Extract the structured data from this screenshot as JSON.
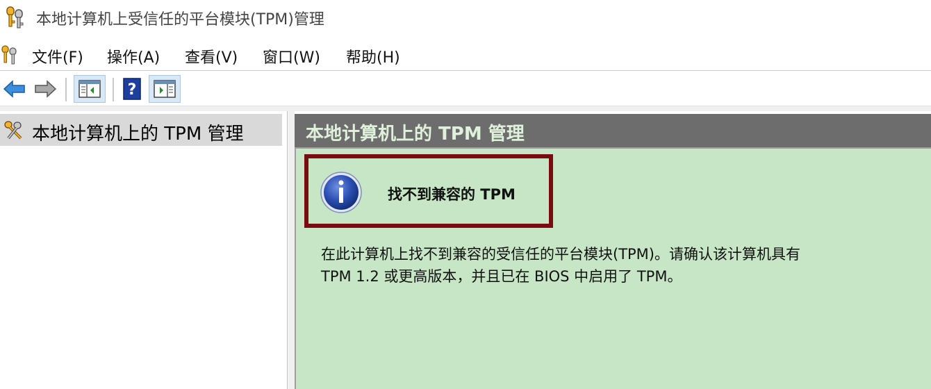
{
  "window": {
    "title": "本地计算机上受信任的平台模块(TPM)管理",
    "icon": "keys-icon"
  },
  "menu": {
    "items": [
      {
        "label": "文件(F)"
      },
      {
        "label": "操作(A)"
      },
      {
        "label": "查看(V)"
      },
      {
        "label": "窗口(W)"
      },
      {
        "label": "帮助(H)"
      }
    ]
  },
  "toolbar": {
    "buttons": [
      {
        "icon": "back-arrow-icon"
      },
      {
        "icon": "forward-arrow-icon"
      },
      {
        "icon": "show-hide-console-tree-icon",
        "pressed": true
      },
      {
        "icon": "help-icon"
      },
      {
        "icon": "show-hide-action-pane-icon",
        "pressed": true
      }
    ]
  },
  "tree": {
    "root_label": "本地计算机上的 TPM 管理"
  },
  "content": {
    "header": "本地计算机上的 TPM 管理",
    "alert_title": "找不到兼容的 TPM",
    "description_line1": "在此计算机上找不到兼容的受信任的平台模块(TPM)。请确认该计算机具有",
    "description_line2": "TPM 1.2 或更高版本，并且已在 BIOS 中启用了 TPM。"
  },
  "colors": {
    "header_bg": "#6d6d6d",
    "header_text": "#dff0db",
    "content_bg": "#c7e6c5",
    "alert_border": "#7a0b10",
    "info_blue": "#2a4fb3"
  }
}
